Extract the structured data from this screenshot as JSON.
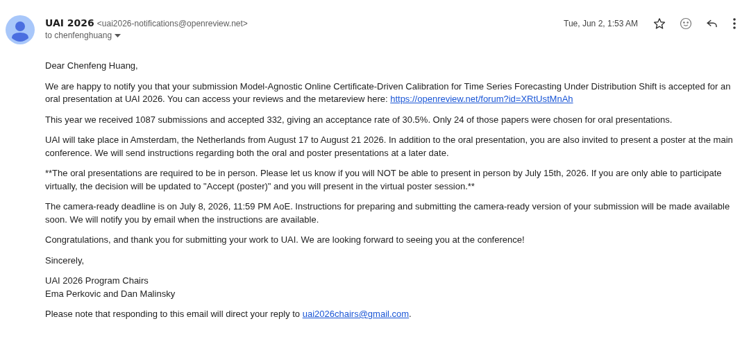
{
  "header": {
    "sender_name": "UAI 2026",
    "sender_email": "<uai2026-notifications@openreview.net>",
    "recipient": "to chenfenghuang",
    "date": "Tue, Jun 2, 1:53 AM",
    "starred": false
  },
  "body": [
    {
      "text": "Dear Chenfeng Huang,"
    },
    {
      "text": "We are happy to notify you that your submission Model-Agnostic Online Certificate-Driven Calibration for Time Series Forecasting Under Distribution Shift is accepted for an oral presentation at UAI 2026. You can access your reviews and the metareview here: ",
      "link": "https://openreview.net/forum?id=XRtUstMnAh"
    },
    {
      "text": "This year we received 1087 submissions and accepted 332, giving an acceptance rate of 30.5%. Only 24 of those papers were chosen for oral presentations."
    },
    {
      "text": "UAI will take place in Amsterdam, the Netherlands from August 17 to August 21 2026. In addition to the oral presentation, you are also invited to present a poster at the main conference. We will send instructions regarding both the oral and poster presentations at a later date."
    },
    {
      "text": "**The oral presentations are required to be in person. Please let us know if you will NOT be able to present in person by July 15th, 2026. If you are only able to participate virtually, the decision will be updated to \"Accept (poster)\" and you will present in the virtual poster session.**"
    },
    {
      "text": "The camera-ready deadline is on July 8, 2026, 11:59 PM AoE. Instructions for preparing and submitting the camera-ready version of your submission will be made available soon. We will notify you by email when the instructions are available."
    },
    {
      "text": "Congratulations, and thank you for submitting your work to UAI. We are looking forward to seeing you at the conference!"
    },
    {
      "text": "Sincerely,"
    },
    {
      "lines": [
        "UAI 2026 Program Chairs",
        "Ema Perkovic and Dan Malinsky"
      ]
    },
    {
      "text": "Please note that responding to this email will direct your reply to ",
      "link": "uai2026chairs@gmail.com",
      "after": "."
    }
  ]
}
